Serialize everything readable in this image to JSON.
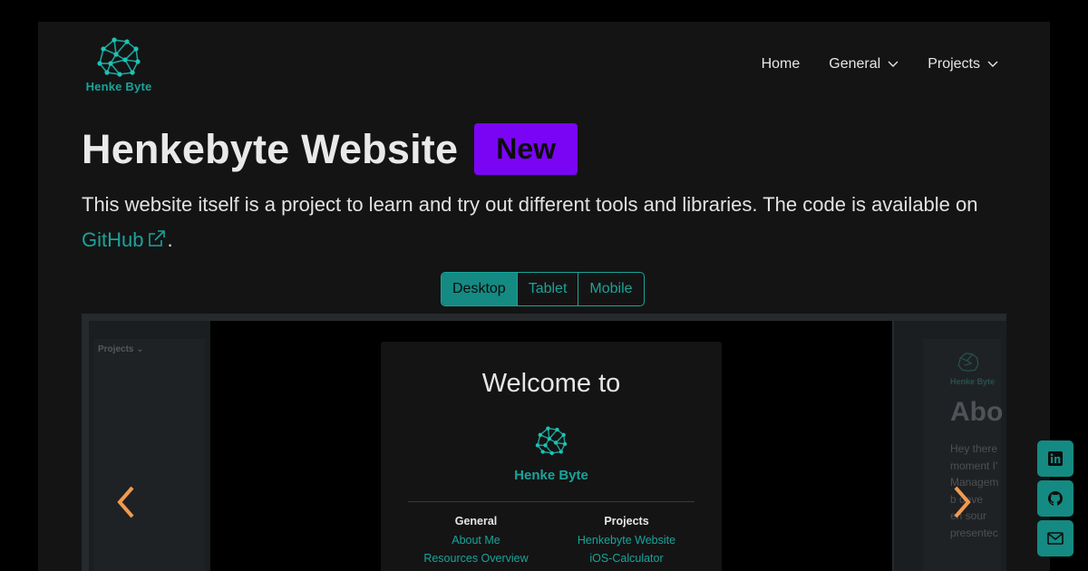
{
  "header": {
    "logo_text": "Henke Byte",
    "nav": [
      {
        "label": "Home",
        "dropdown": false
      },
      {
        "label": "General",
        "dropdown": true
      },
      {
        "label": "Projects",
        "dropdown": true
      }
    ]
  },
  "hero": {
    "title": "Henkebyte Website",
    "badge": "New",
    "description": "This website itself is a project to learn and try out different tools and libraries. The code is available on",
    "link_label": "GitHub",
    "trailing": "."
  },
  "view_switch": {
    "options": [
      "Desktop",
      "Tablet",
      "Mobile"
    ],
    "selected": "Desktop"
  },
  "carousel": {
    "prev_icon": "chevron-left-icon",
    "next_icon": "chevron-right-icon",
    "left_preview": {
      "label": "Projects"
    },
    "right_preview": {
      "logo_text": "Henke Byte",
      "heading": "Abo",
      "lines": [
        "Hey there",
        "moment I'",
        "Managem",
        "b deve",
        "en sour",
        "presentec"
      ]
    },
    "slide": {
      "welcome": "Welcome to",
      "logo_text": "Henke Byte",
      "columns": [
        {
          "heading": "General",
          "links": [
            "About Me",
            "Resources Overview"
          ]
        },
        {
          "heading": "Projects",
          "links": [
            "Henkebyte Website",
            "iOS-Calculator"
          ]
        }
      ]
    }
  },
  "social": [
    {
      "name": "linkedin-icon"
    },
    {
      "name": "github-icon"
    },
    {
      "name": "mail-icon"
    }
  ],
  "colors": {
    "accent": "#1aa39a",
    "badge": "#7a05f5",
    "arrow": "#f29a50",
    "background": "#141414"
  }
}
